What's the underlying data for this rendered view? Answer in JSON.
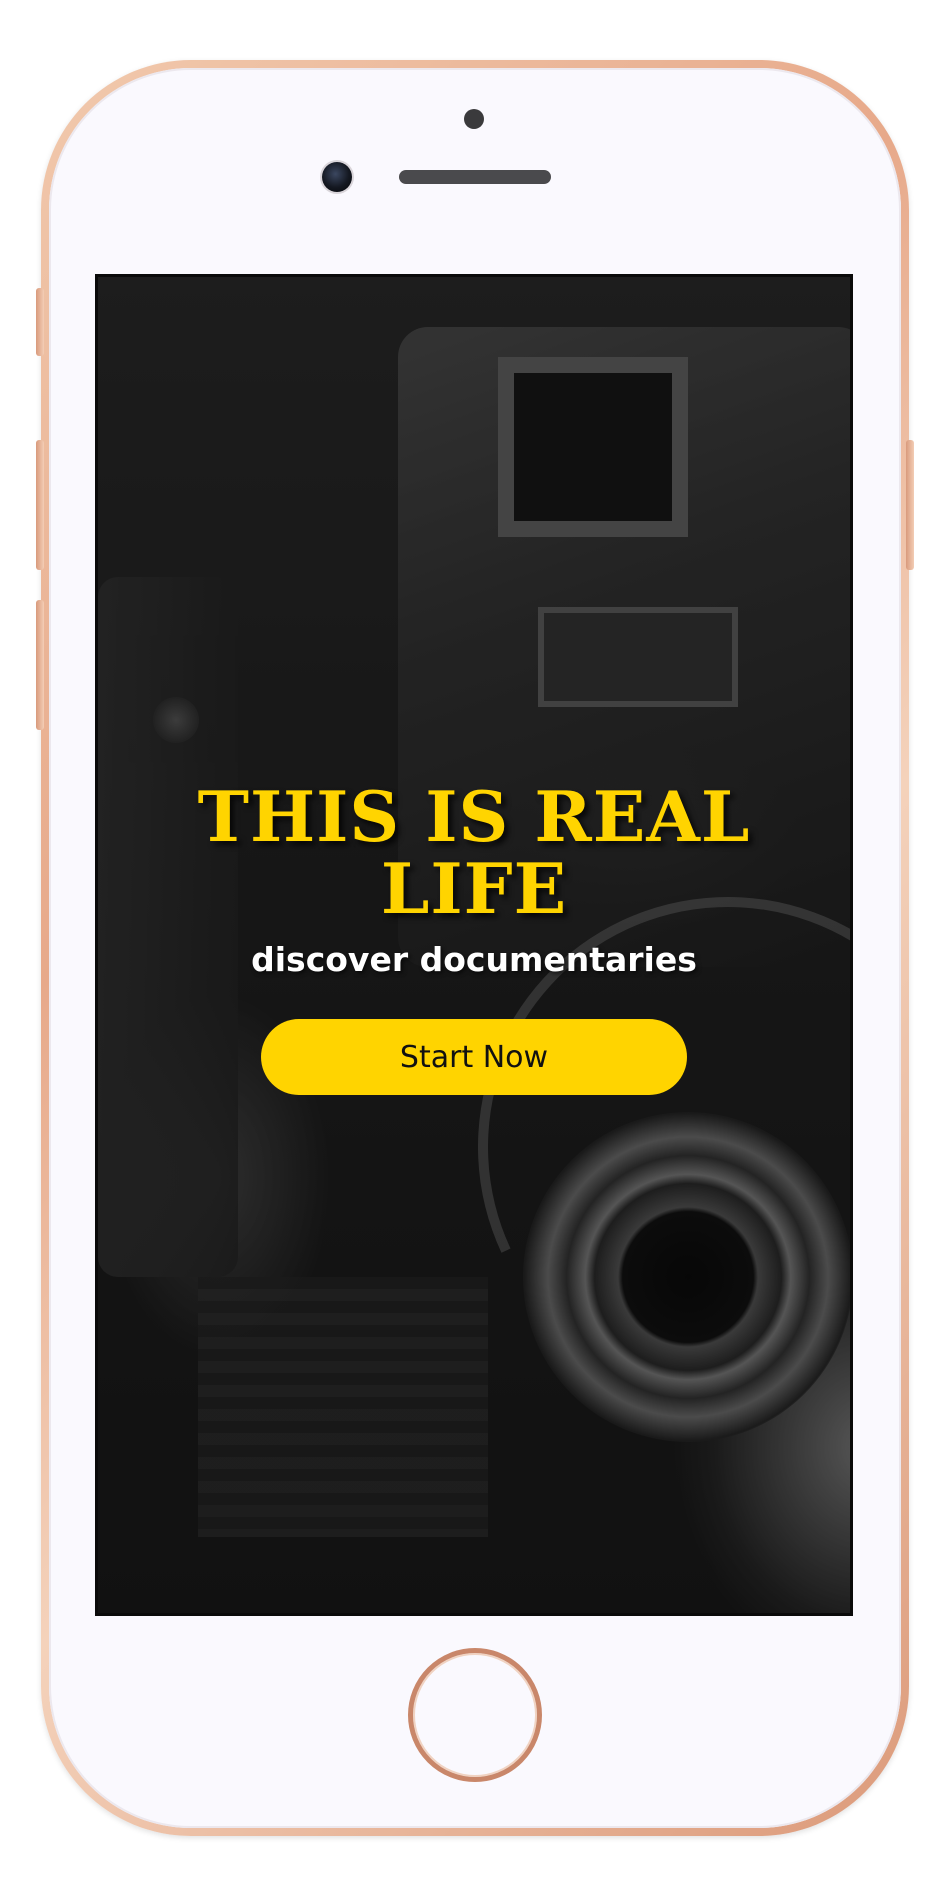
{
  "hero": {
    "title": "THIS IS REAL LIFE",
    "subtitle": "discover documentaries",
    "cta_label": "Start Now"
  },
  "colors": {
    "accent": "#ffd400",
    "subtitle_text": "#ffffff",
    "button_text": "#111111",
    "phone_frame": "#e7a98a",
    "phone_face": "#faf9fe"
  },
  "icons": {
    "home": "home-button-ring",
    "camera": "front-camera-icon",
    "speaker": "speaker-grille",
    "sensor": "sensor-dot"
  }
}
